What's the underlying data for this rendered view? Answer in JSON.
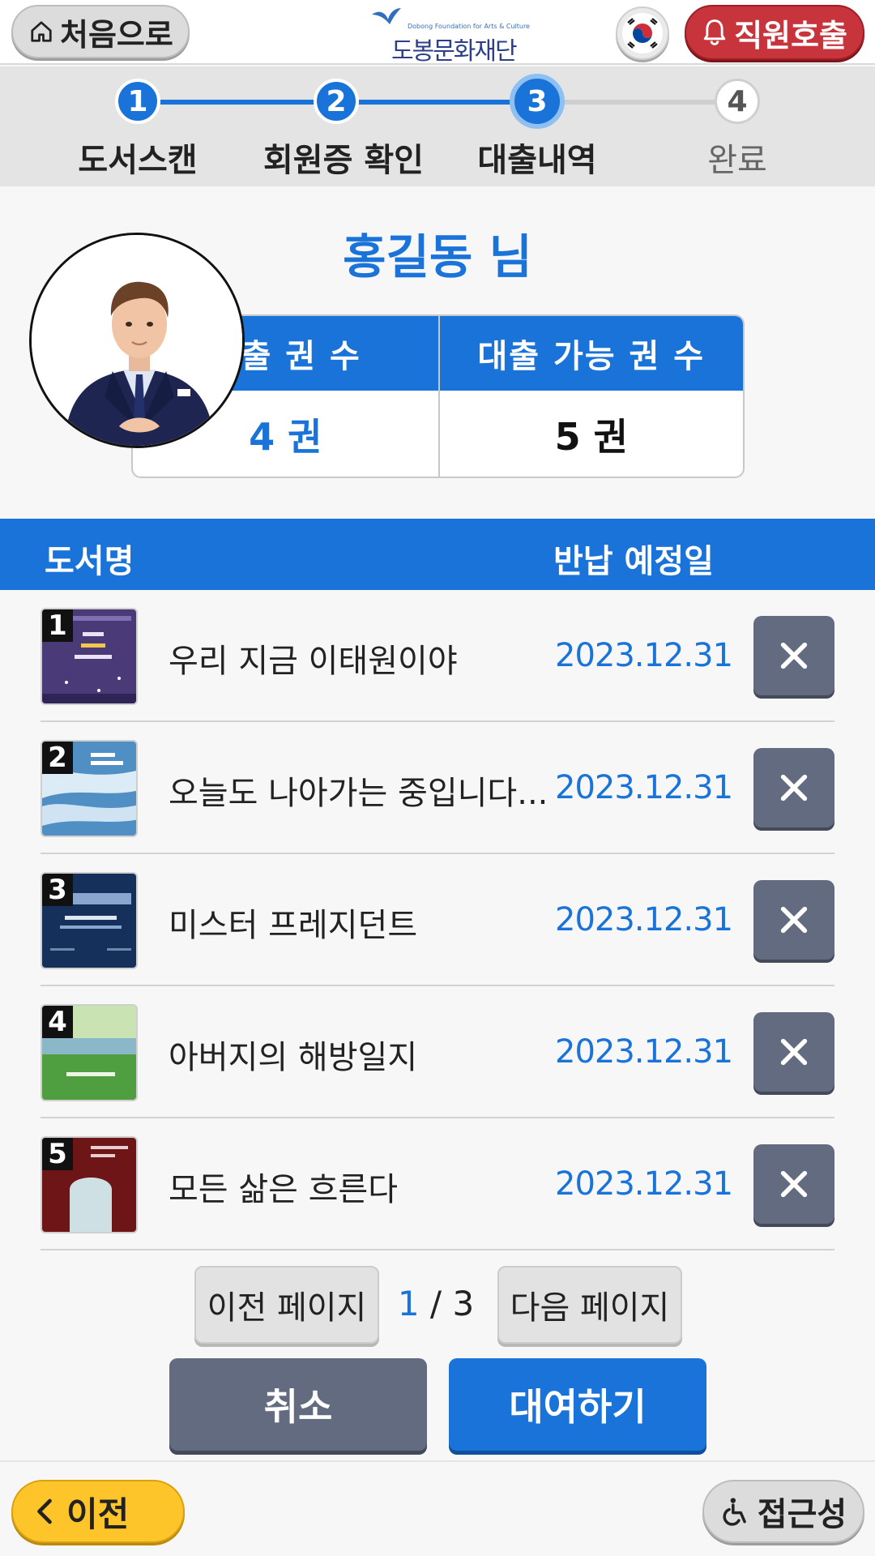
{
  "header": {
    "home_label": "처음으로",
    "logo_subtitle": "Dobong Foundation for Arts & Culture",
    "logo_title": "도봉문화재단",
    "call_staff_label": "직원호출"
  },
  "steps": [
    {
      "number": "1",
      "label": "도서스캔",
      "state": "done"
    },
    {
      "number": "2",
      "label": "회원증 확인",
      "state": "done"
    },
    {
      "number": "3",
      "label": "대출내역",
      "state": "active"
    },
    {
      "number": "4",
      "label": "완료",
      "state": "pending"
    }
  ],
  "member": {
    "greeting": "홍길동 님",
    "loan_count_label": "대출 권 수",
    "loan_count_value": "4 권",
    "available_label": "대출 가능 권 수",
    "available_value": "5 권"
  },
  "table": {
    "col_title": "도서명",
    "col_due": "반납 예정일",
    "rows": [
      {
        "num": "1",
        "title": "우리 지금 이태원이야",
        "due": "2023.12.31",
        "cover": "purple-night"
      },
      {
        "num": "2",
        "title": "오늘도 나아가는 중입니다...",
        "due": "2023.12.31",
        "cover": "blue-waves"
      },
      {
        "num": "3",
        "title": "미스터 프레지던트",
        "due": "2023.12.31",
        "cover": "navy-president"
      },
      {
        "num": "4",
        "title": "아버지의 해방일지",
        "due": "2023.12.31",
        "cover": "green-field"
      },
      {
        "num": "5",
        "title": "모든 삶은 흐른다",
        "due": "2023.12.31",
        "cover": "red-arch"
      }
    ]
  },
  "pager": {
    "prev_label": "이전 페이지",
    "current": "1",
    "separator": "/",
    "total": "3",
    "next_label": "다음 페이지"
  },
  "actions": {
    "cancel_label": "취소",
    "borrow_label": "대여하기"
  },
  "footer": {
    "back_label": "이전",
    "accessibility_label": "접근성"
  },
  "colors": {
    "primary": "#1a73d8",
    "danger": "#c8343b",
    "muted_button": "#636b80",
    "back_button": "#fdc52a"
  }
}
